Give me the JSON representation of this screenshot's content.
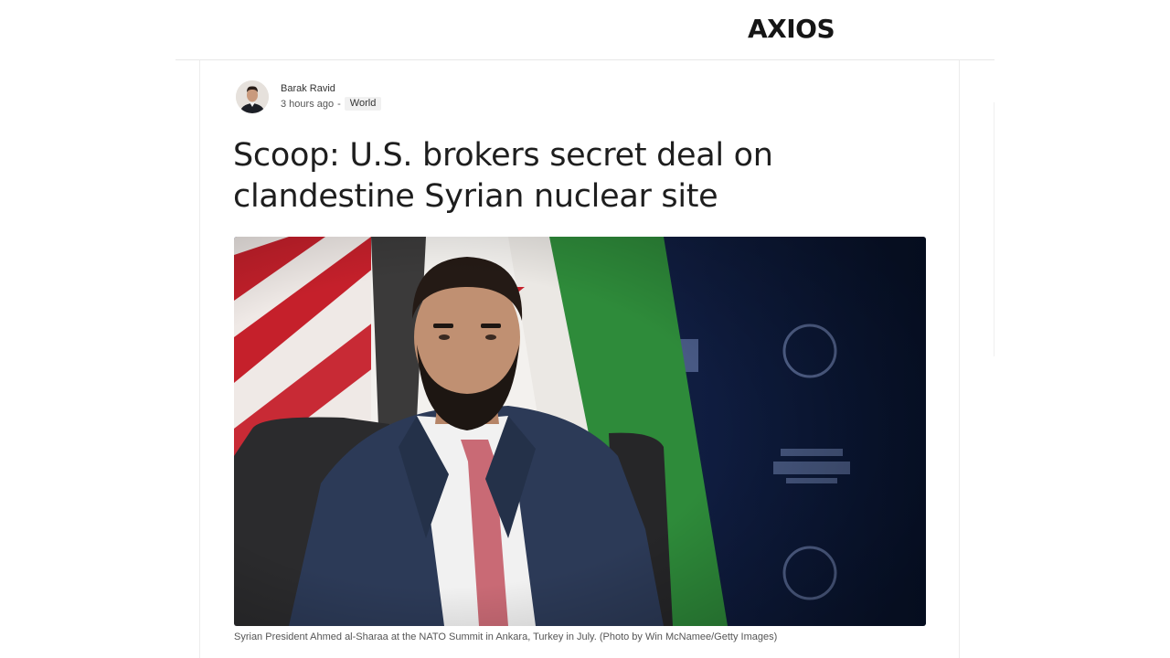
{
  "brand": {
    "logo_text": "AXIOS"
  },
  "byline": {
    "author": "Barak Ravid",
    "timestamp": "3 hours ago",
    "separator": "-",
    "category": "World"
  },
  "article": {
    "headline": "Scoop: U.S. brokers secret deal on clandestine Syrian nuclear site",
    "caption": "Syrian President Ahmed al-Sharaa at the NATO Summit in Ankara, Turkey in July. (Photo by Win McNamee/Getty Images)"
  },
  "colors": {
    "backdrop_navy": "#0f1f4a",
    "flag_green": "#2e8b3a",
    "flag_red": "#c5202b",
    "text_primary": "#1e1e1e"
  }
}
